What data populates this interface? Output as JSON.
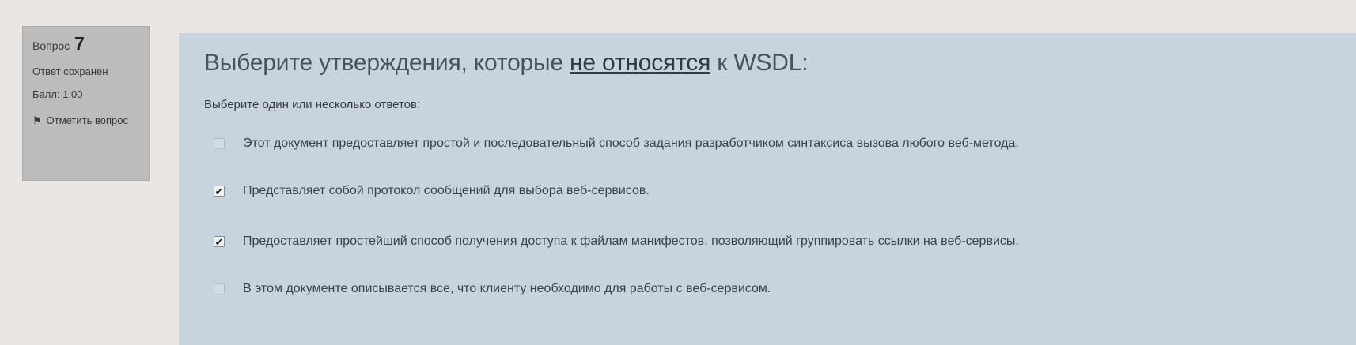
{
  "question_info": {
    "question_label": "Вопрос",
    "question_number": "7",
    "status": "Ответ сохранен",
    "points": "Балл: 1,00",
    "flag_label": "Отметить вопрос"
  },
  "question": {
    "text_before": "Выберите утверждения, которые ",
    "text_underlined": "не относятся",
    "text_after": " к WSDL:",
    "prompt": "Выберите один или несколько ответов:",
    "options": [
      {
        "label": "Этот документ предоставляет простой и последовательный способ задания разработчиком синтаксиса вызова любого веб-метода.",
        "checked": false
      },
      {
        "label": "Представляет собой протокол сообщений для выбора веб-сервисов.",
        "checked": true
      },
      {
        "label": "Предоставляет простейший способ получения доступа к файлам манифестов, позволяющий группировать ссылки на веб-сервисы.",
        "checked": true
      },
      {
        "label": "В этом документе описывается все, что клиенту необходимо для работы с веб-сервисом.",
        "checked": false
      }
    ]
  },
  "icons": {
    "flag": "flag-icon",
    "check": "check-icon"
  },
  "colors": {
    "content_bg": "#c8d4dd",
    "info_bg": "#bdbcbc"
  }
}
